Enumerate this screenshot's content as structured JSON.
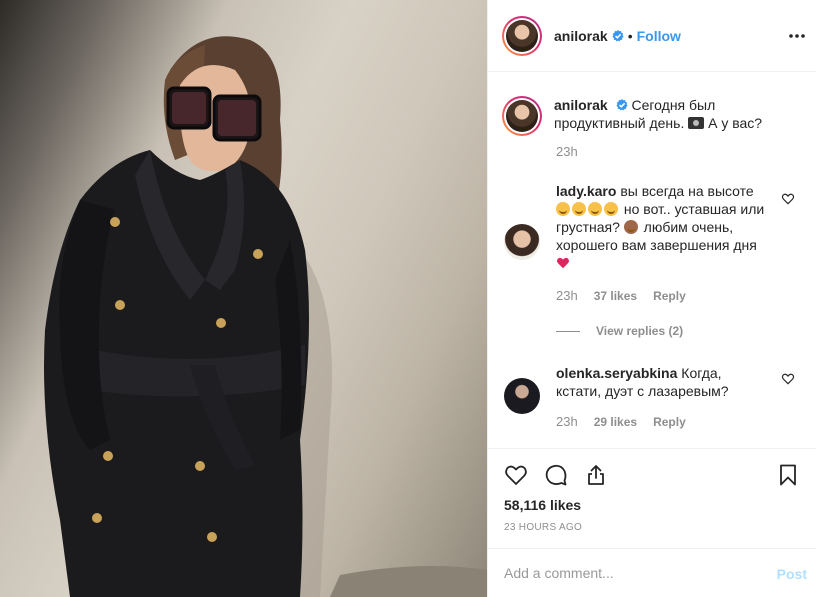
{
  "post": {
    "username": "anilorak",
    "follow_label": "Follow",
    "dot": "•",
    "caption": {
      "username": "anilorak",
      "text_1": "Сегодня был продуктивный день.",
      "text_2": "А у вас?",
      "time": "23h"
    },
    "comments": [
      {
        "username": "lady.karo",
        "text_1": "вы всегда на высоте",
        "text_2": "но вот.. уставшая или грустная?",
        "text_3": "любим очень, хорошего вам завершения дня",
        "time": "23h",
        "likes": "37 likes",
        "reply": "Reply"
      },
      {
        "username": "olenka.seryabkina",
        "text_1": "Когда, кстати, дуэт с лазаревым?",
        "time": "23h",
        "likes": "29 likes",
        "reply": "Reply"
      }
    ],
    "view_replies": "View replies (2)",
    "likes_count": "58,116 likes",
    "time_ago": "23 HOURS AGO",
    "add_comment_placeholder": "Add a comment...",
    "post_label": "Post"
  },
  "colors": {
    "accent": "#3897f0",
    "muted": "#8e8e8e",
    "post_disabled": "#b2dffc"
  },
  "icons": [
    "verified-badge-icon",
    "more-options-icon",
    "heart-icon",
    "comment-icon",
    "share-icon",
    "bookmark-icon",
    "camera-emoji",
    "grinning-emoji",
    "monkey-emoji",
    "red-heart-emoji"
  ]
}
